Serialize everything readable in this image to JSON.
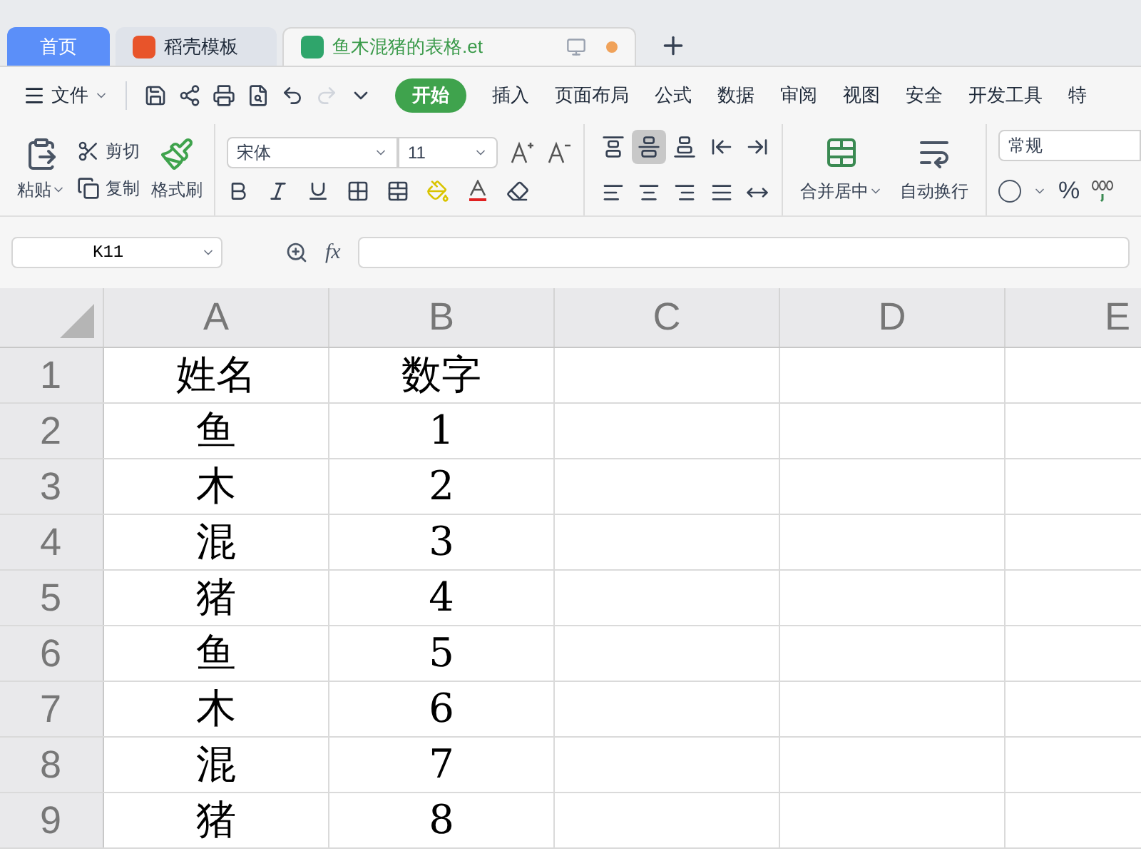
{
  "tabs": [
    {
      "kind": "home",
      "label": "首页",
      "selected": false
    },
    {
      "kind": "template",
      "label": "稻壳模板",
      "selected": false
    },
    {
      "kind": "sheet",
      "label": "鱼木混猪的表格.et",
      "selected": true
    }
  ],
  "menu": {
    "file": "文件",
    "items": [
      {
        "label": "开始",
        "selected": true
      },
      {
        "label": "插入",
        "selected": false
      },
      {
        "label": "页面布局",
        "selected": false
      },
      {
        "label": "公式",
        "selected": false
      },
      {
        "label": "数据",
        "selected": false
      },
      {
        "label": "审阅",
        "selected": false
      },
      {
        "label": "视图",
        "selected": false
      },
      {
        "label": "安全",
        "selected": false
      },
      {
        "label": "开发工具",
        "selected": false
      },
      {
        "label": "特",
        "selected": false
      }
    ]
  },
  "ribbon": {
    "paste": "粘贴",
    "cut": "剪切",
    "copy": "复制",
    "format_painter": "格式刷",
    "font": "宋体",
    "font_size": "11",
    "align": [
      {
        "kind": "top",
        "selected": false
      },
      {
        "kind": "middle",
        "selected": true
      },
      {
        "kind": "bottom",
        "selected": false
      },
      {
        "kind": "outdent",
        "selected": false
      },
      {
        "kind": "indent",
        "selected": false
      },
      {
        "kind": "left",
        "selected": false
      },
      {
        "kind": "center",
        "selected": false
      },
      {
        "kind": "right",
        "selected": false
      },
      {
        "kind": "justify",
        "selected": false
      },
      {
        "kind": "distribute",
        "selected": false
      }
    ],
    "merge": "合并居中",
    "wrap": "自动换行",
    "number_format": "常规",
    "percent": "%"
  },
  "formula_bar": {
    "cell": "K11",
    "fx": "fx"
  },
  "sheet": {
    "columns": [
      "A",
      "B",
      "C",
      "D",
      "E"
    ],
    "rows": [
      {
        "number": "1",
        "cells": [
          "姓名",
          "数字"
        ]
      },
      {
        "number": "2",
        "cells": [
          "鱼",
          "1"
        ]
      },
      {
        "number": "3",
        "cells": [
          "木",
          "2"
        ]
      },
      {
        "number": "4",
        "cells": [
          "混",
          "3"
        ]
      },
      {
        "number": "5",
        "cells": [
          "猪",
          "4"
        ]
      },
      {
        "number": "6",
        "cells": [
          "鱼",
          "5"
        ]
      },
      {
        "number": "7",
        "cells": [
          "木",
          "6"
        ]
      },
      {
        "number": "8",
        "cells": [
          "混",
          "7"
        ]
      },
      {
        "number": "9",
        "cells": [
          "猪",
          "8"
        ]
      }
    ]
  }
}
